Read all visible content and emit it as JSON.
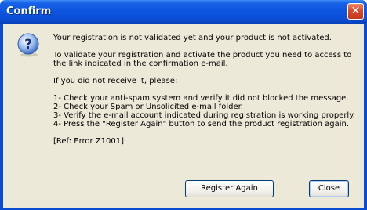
{
  "window": {
    "title": "Confirm",
    "close_glyph": "✕"
  },
  "dialog": {
    "icon": "question-icon",
    "lines": {
      "l1": "Your registration is not validated yet and your product is not activated.",
      "l2": "To validate your registration and activate the product you need to access to",
      "l3": "the link indicated in the confirmation e-mail.",
      "l4": "If you did not receive it, please:",
      "l5": "1- Check your anti-spam system and verify it did not blocked the message.",
      "l6": "2- Check your Spam or Unsolicited e-mail folder.",
      "l7": "3- Verify the e-mail account indicated during registration is working properly.",
      "l8": "4- Press the \"Register Again\" button to send the product registration again.",
      "l9": "[Ref: Error Z1001]"
    }
  },
  "buttons": {
    "register_again": "Register Again",
    "close": "Close"
  },
  "colors": {
    "titlebar": "#0a56e0",
    "client": "#ece9d8",
    "close_button": "#d9482b"
  }
}
